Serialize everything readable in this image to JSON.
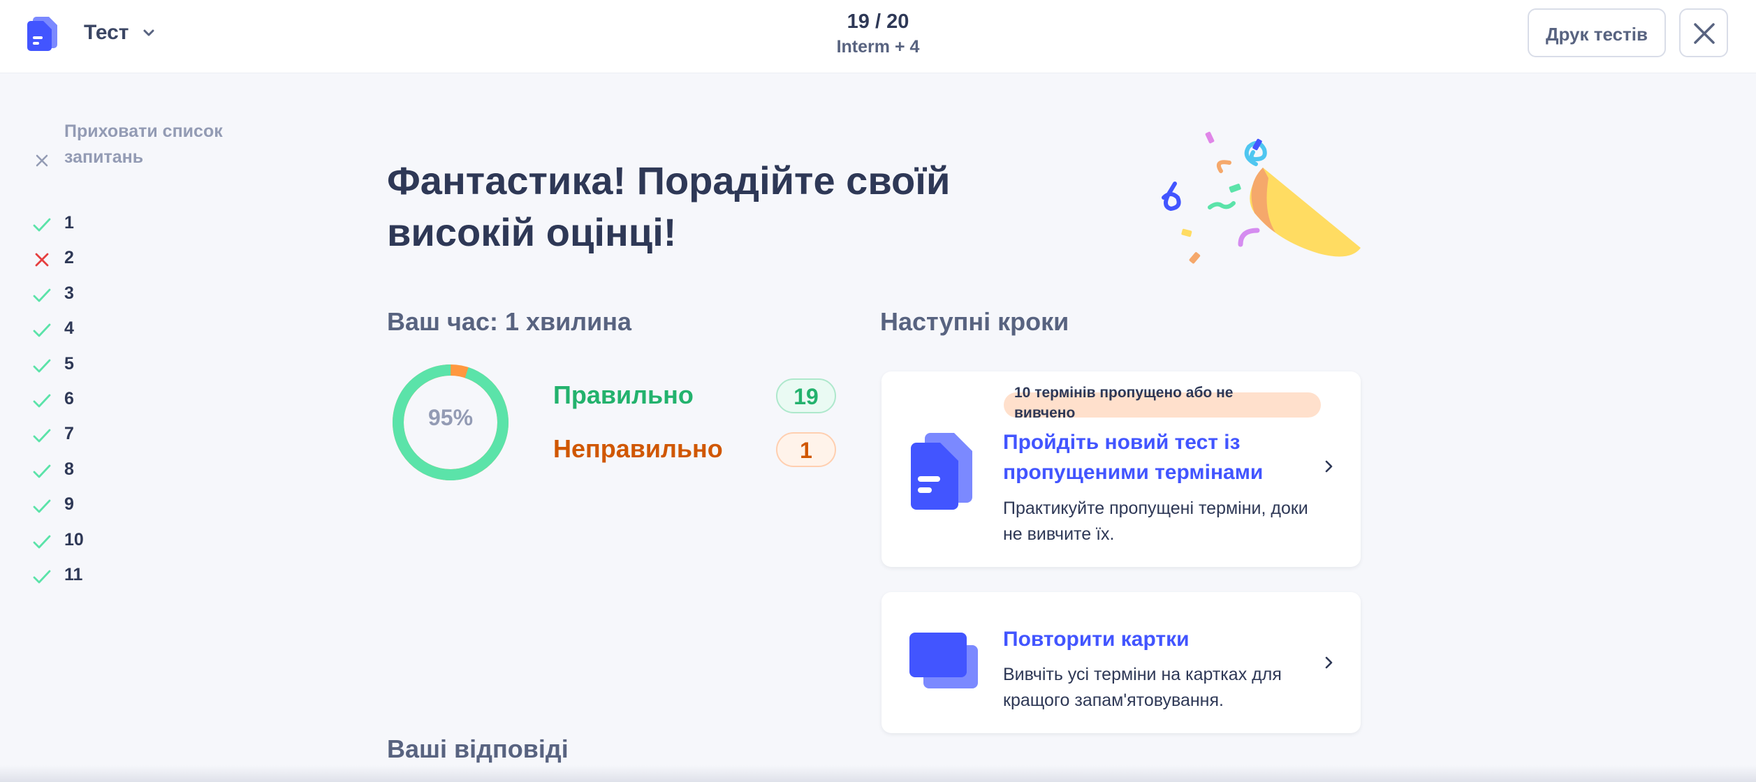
{
  "header": {
    "mode_label": "Тест",
    "progress_count": "19 / 20",
    "set_name": "Interm + 4",
    "print_label": "Друк тестів"
  },
  "sidebar": {
    "hide_list_label": "Приховати список запитань",
    "questions": [
      {
        "number": "1",
        "status": "correct"
      },
      {
        "number": "2",
        "status": "incorrect"
      },
      {
        "number": "3",
        "status": "correct"
      },
      {
        "number": "4",
        "status": "correct"
      },
      {
        "number": "5",
        "status": "correct"
      },
      {
        "number": "6",
        "status": "correct"
      },
      {
        "number": "7",
        "status": "correct"
      },
      {
        "number": "8",
        "status": "correct"
      },
      {
        "number": "9",
        "status": "correct"
      },
      {
        "number": "10",
        "status": "correct"
      },
      {
        "number": "11",
        "status": "correct"
      }
    ]
  },
  "results": {
    "headline": "Фантастика! Порадійте своїй високій оцінці!",
    "time_label": "Ваш час: 1 хвилина",
    "score_percent": 95,
    "score_label": "95%",
    "correct_label": "Правильно",
    "correct_count": "19",
    "incorrect_label": "Неправильно",
    "incorrect_count": "1",
    "answers_title": "Ваші відповіді"
  },
  "next_steps": {
    "title": "Наступні кроки",
    "cards": [
      {
        "banner": "10 термінів пропущено або не вивчено",
        "title": "Пройдіть новий тест із пропущеними термінами",
        "description": "Практикуйте пропущені терміни, доки не вивчите їх."
      },
      {
        "title": "Повторити картки",
        "description": "Вивчіть усі терміни на картках для кращого запам'ятовування."
      }
    ]
  },
  "colors": {
    "accent": "#4255ff",
    "correct": "#23b26d",
    "incorrect": "#d05700",
    "donut_correct": "#5be3a9",
    "donut_incorrect": "#ff983f",
    "text": "#2e3856",
    "muted": "#939bb4"
  }
}
